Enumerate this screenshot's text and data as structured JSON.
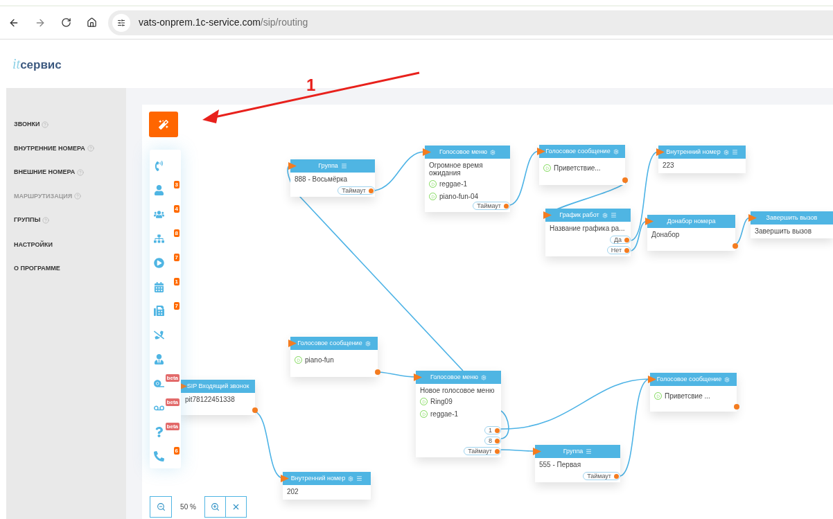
{
  "browser": {
    "url_host": "vats-onprem.1c-service.com",
    "url_path": "/sip/routing"
  },
  "logo": {
    "prefix": "it",
    "name": "сервис"
  },
  "sidebar": {
    "sections": [
      {
        "items": [
          {
            "label": "ЗВОНКИ",
            "help": true,
            "selected": false
          },
          {
            "label": "ВНУТРЕННИЕ НОМЕРА",
            "help": true,
            "selected": false
          },
          {
            "label": "ВНЕШНИЕ НОМЕРА",
            "help": true,
            "selected": false
          },
          {
            "label": "МАРШРУТИЗАЦИЯ",
            "help": true,
            "selected": true
          },
          {
            "label": "ГРУППЫ",
            "help": true,
            "selected": false
          }
        ]
      },
      {
        "items": [
          {
            "label": "НАСТРОЙКИ",
            "help": false,
            "selected": false
          },
          {
            "label": "О ПРОГРАММЕ",
            "help": false,
            "selected": false
          }
        ]
      }
    ]
  },
  "annotation": {
    "label": "1"
  },
  "toolbar": {
    "items": [
      {
        "kind": "incoming-call"
      },
      {
        "kind": "user",
        "badge": {
          "text": "3",
          "color": "#ff6a00"
        }
      },
      {
        "kind": "users",
        "badge": {
          "text": "4",
          "color": "#ff6a00"
        }
      },
      {
        "kind": "routing",
        "badge": {
          "text": "8",
          "color": "#ff6a00"
        }
      },
      {
        "kind": "play",
        "badge": {
          "text": "7",
          "color": "#ff6a00"
        }
      },
      {
        "kind": "calendar",
        "badge": {
          "text": "1",
          "color": "#ff6a00"
        }
      },
      {
        "kind": "fax",
        "badge": {
          "text": "7",
          "color": "#ff6a00"
        }
      },
      {
        "kind": "hangup"
      },
      {
        "kind": "crm"
      },
      {
        "kind": "tape",
        "badge": {
          "text": "beta",
          "color": "#e26a6a"
        }
      },
      {
        "kind": "voicemail",
        "badge": {
          "text": "beta",
          "color": "#e26a6a"
        }
      },
      {
        "kind": "question",
        "badge": {
          "text": "beta",
          "color": "#e26a6a"
        }
      },
      {
        "kind": "sip-phone",
        "badge": {
          "text": "6",
          "color": "#ff6a00"
        }
      }
    ]
  },
  "zoom": {
    "value": "50 %"
  },
  "canvas": {
    "nodes": [
      {
        "title": "Группа",
        "settings": false,
        "menu": true,
        "description": "888 - Восьмёрка",
        "ports": [
          "Таймаут"
        ]
      },
      {
        "title": "Голосовое меню",
        "settings": true,
        "menu": false,
        "description": "Огромное время ожидания",
        "tracks": [
          "reggae-1",
          "piano-fun-04"
        ],
        "ports": [
          "Таймаут"
        ]
      },
      {
        "title": "Голосовое сообщение",
        "settings": true,
        "menu": false,
        "tracks": [
          "Приветствие..."
        ],
        "output": true
      },
      {
        "title": "Внутренний номер",
        "settings": true,
        "menu": true,
        "description": "223"
      },
      {
        "title": "График работ",
        "settings": true,
        "menu": true,
        "description": "Название графика ра...",
        "ports": [
          "Да",
          "Нет"
        ]
      },
      {
        "title": "Донабор номера",
        "settings": false,
        "menu": false,
        "description": "Донабор",
        "output": true
      },
      {
        "title": "Завершить вызов",
        "settings": false,
        "menu": false,
        "description": "Завершить вызов"
      },
      {
        "title": "Голосовое сообщение",
        "settings": true,
        "menu": false,
        "tracks": [
          "piano-fun"
        ],
        "output": true
      },
      {
        "title": "Голосовое меню",
        "settings": true,
        "menu": false,
        "description": "Новое голосовое меню",
        "tracks": [
          "Ring09",
          "reggae-1"
        ],
        "ports": [
          "1",
          "8",
          "Таймаут"
        ]
      },
      {
        "title": "Голосовое сообщение",
        "settings": true,
        "menu": false,
        "tracks": [
          "Приветсвие ..."
        ],
        "output": true
      },
      {
        "title": "Группа",
        "settings": false,
        "menu": true,
        "description": "555 - Первая",
        "ports": [
          "Таймаут"
        ]
      },
      {
        "title": "Внутренний номер",
        "settings": true,
        "menu": true,
        "description": "202"
      },
      {
        "title": "SIP Входящий звонок",
        "settings": false,
        "menu": false,
        "description": "pit78122451338",
        "output": true
      }
    ]
  }
}
